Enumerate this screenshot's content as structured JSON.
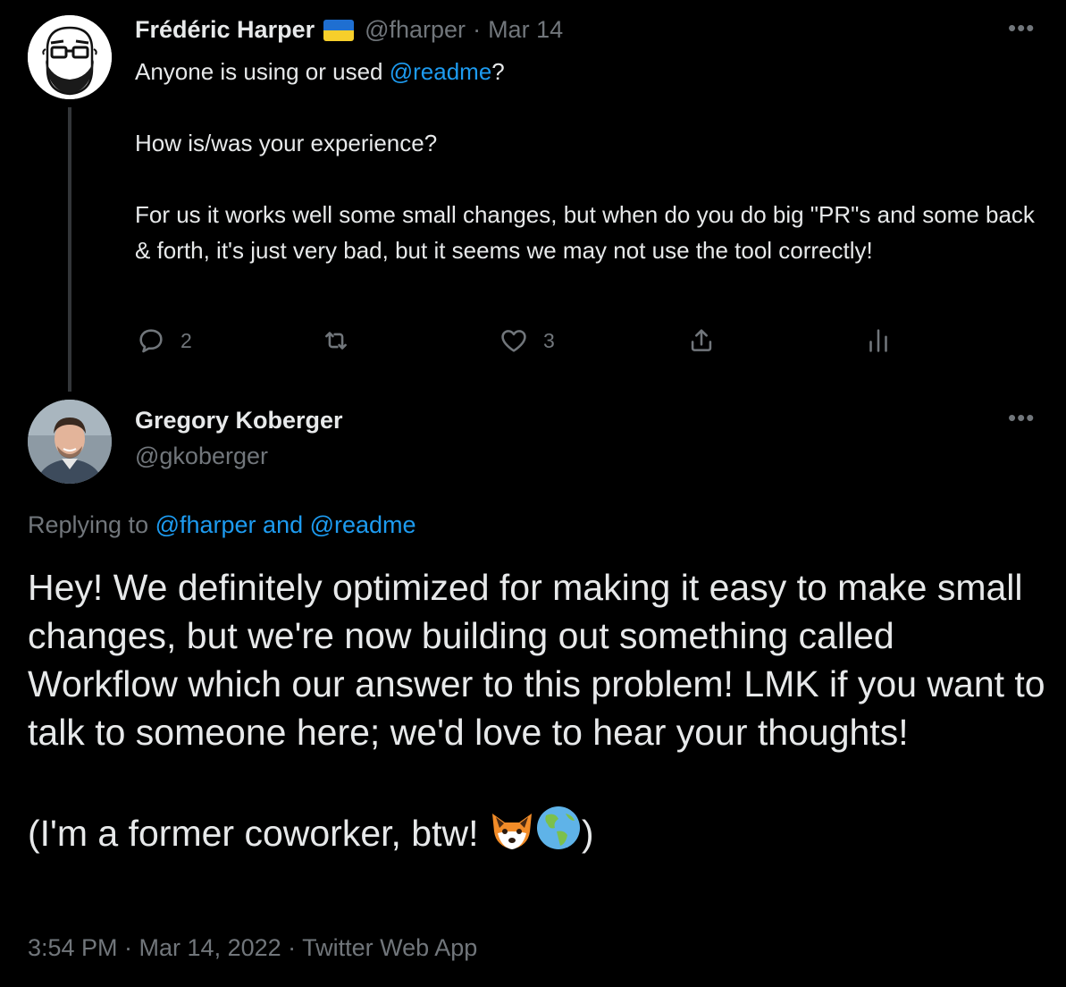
{
  "tweet1": {
    "display_name": "Frédéric Harper",
    "flag_icon": "ukraine-flag-icon",
    "handle": "@fharper",
    "separator": "·",
    "date": "Mar 14",
    "text_before_mention": "Anyone is using or used ",
    "mention": "@readme",
    "text_after_mention": "?\n\nHow is/was your experience?\n\nFor us it works well some small changes, but when do you do big \"PR\"s and some back & forth, it's just very bad, but it seems we may not use the tool correctly!",
    "actions": {
      "reply_count": "2",
      "retweet_count": "",
      "like_count": "3"
    }
  },
  "tweet2": {
    "display_name": "Gregory Koberger",
    "handle": "@gkoberger",
    "replying_prefix": "Replying to ",
    "replying_mentions": "@fharper and @readme",
    "text_main": "Hey! We definitely optimized for making it easy to make small changes, but we're now building out something called Workflow which our answer to this problem! LMK if you want to talk to someone here; we'd love to hear your thoughts!\n\n(I'm a former coworker, btw! ",
    "text_end": ")",
    "emojis": [
      "fox-face-emoji",
      "globe-americas-emoji"
    ],
    "meta": "3:54 PM · Mar 14, 2022 · Twitter Web App"
  },
  "colors": {
    "background": "#000000",
    "text": "#e7e9ea",
    "muted": "#71767b",
    "link": "#1d9bf0"
  }
}
